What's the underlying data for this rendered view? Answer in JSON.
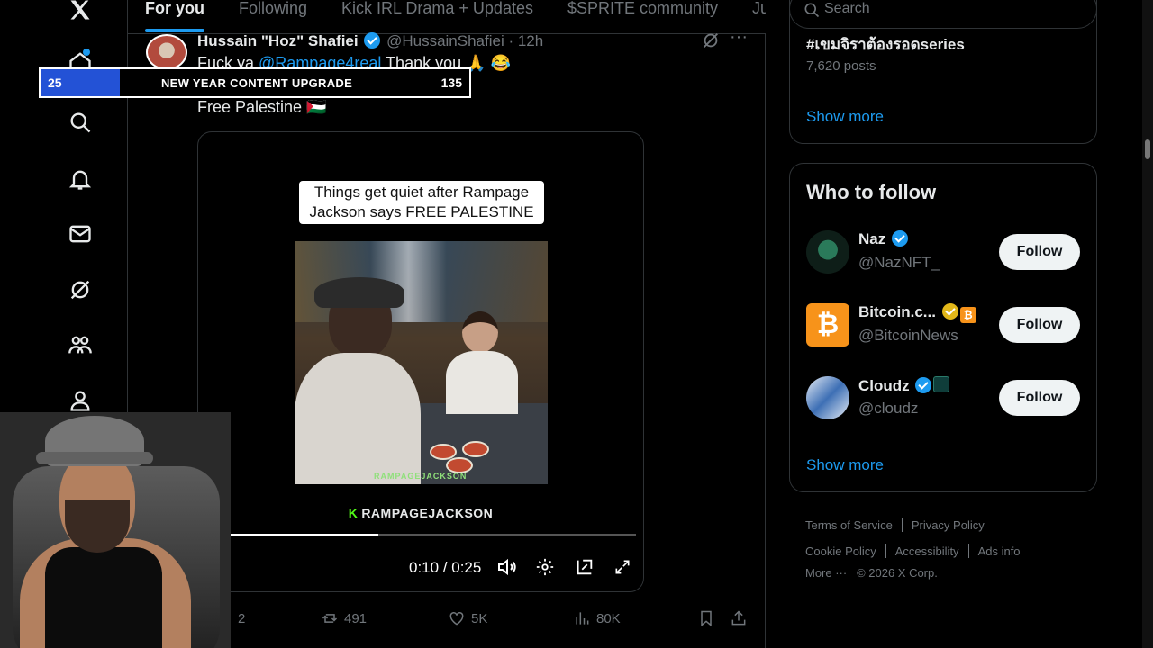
{
  "tabs": [
    {
      "label": "For you",
      "active": true
    },
    {
      "label": "Following"
    },
    {
      "label": "Kick IRL Drama + Updates"
    },
    {
      "label": "$SPRITE community"
    },
    {
      "label": "Jup"
    }
  ],
  "nav": {
    "icons": [
      "x-logo-icon",
      "home-icon",
      "search-icon",
      "bell-icon",
      "mail-icon",
      "grok-icon",
      "communities-icon",
      "profile-icon"
    ]
  },
  "post": {
    "author_name": "Hussain \"Hoz\" Shafiei",
    "handle": "@HussainShafiei",
    "time": "· 12h",
    "line1_pre": "Fuck ya ",
    "mention": "@Rampage4real",
    "line1_post": " Thank you 🙏 😂",
    "line2": "Free Palestine 🇵🇸",
    "media": {
      "caption": "Things get quiet after Rampage Jackson says FREE PALESTINE",
      "watermark": "RAMPAGEJACKSON",
      "brand_k": "K",
      "brand": "RAMPAGEJACKSON",
      "time": "0:10 / 0:25",
      "progress": 0.4
    },
    "actions": {
      "replies": "2",
      "reposts": "491",
      "likes": "5K",
      "views": "80K"
    }
  },
  "search": {
    "placeholder": "Search"
  },
  "trend": {
    "title": "#เขมจิราต้องรอดseries",
    "posts": "7,620 posts",
    "show_more": "Show more"
  },
  "who_to_follow": {
    "title": "Who to follow",
    "accounts": [
      {
        "name": "Naz",
        "handle": "@NazNFT_",
        "button": "Follow"
      },
      {
        "name": "Bitcoin.c...",
        "handle": "@BitcoinNews",
        "button": "Follow"
      },
      {
        "name": "Cloudz",
        "handle": "@cloudz",
        "button": "Follow"
      }
    ],
    "show_more": "Show more"
  },
  "footer": {
    "terms": "Terms of Service",
    "privacy": "Privacy Policy",
    "cookie": "Cookie Policy",
    "accessibility": "Accessibility",
    "ads": "Ads info",
    "more": "More ···",
    "copyright": "© 2026 X Corp."
  },
  "banner": {
    "current": "25",
    "title": "NEW YEAR CONTENT UPGRADE",
    "target": "135",
    "progress": 0.185
  },
  "colors": {
    "accent": "#1d9bf0",
    "banner_fill": "#2352d6",
    "kick_green": "#53fc18"
  }
}
